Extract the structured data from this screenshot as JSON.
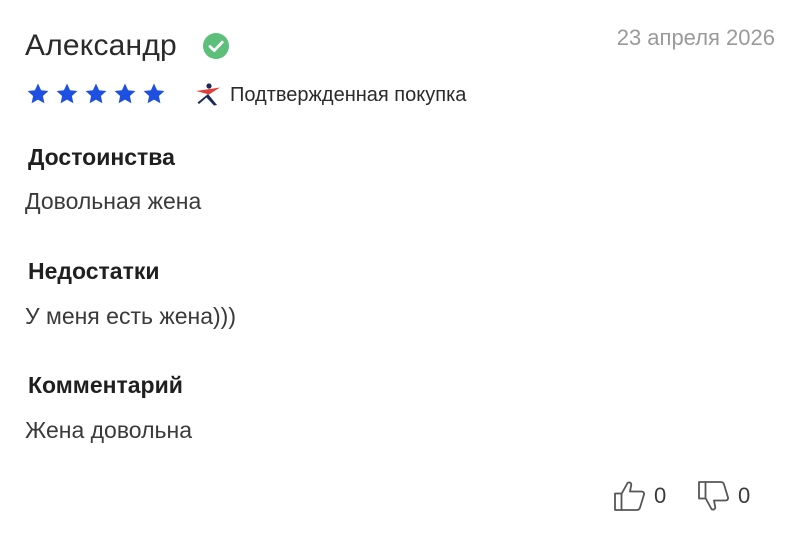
{
  "review": {
    "author": "Александр",
    "date": "23 апреля 2026",
    "rating": 5,
    "rating_max": 5,
    "verified_label": "Подтвержденная покупка",
    "sections": {
      "pros_title": "Достоинства",
      "pros_text": "Довольная жена",
      "cons_title": "Недостатки",
      "cons_text": "У меня есть жена)))",
      "comment_title": "Комментарий",
      "comment_text": "Жена довольна"
    },
    "likes": "0",
    "dislikes": "0"
  },
  "icons": {
    "verified": "check-circle-icon",
    "star": "star-icon",
    "brand": "runner-logo-icon",
    "like": "thumbs-up-icon",
    "dislike": "thumbs-down-icon"
  },
  "colors": {
    "verified_green": "#5cbf7a",
    "star_blue": "#1d4fe0",
    "brand_red": "#e0403a",
    "brand_navy": "#1a2a5a",
    "date_gray": "#9a9a9a",
    "text_dark": "#1f1f1f"
  }
}
